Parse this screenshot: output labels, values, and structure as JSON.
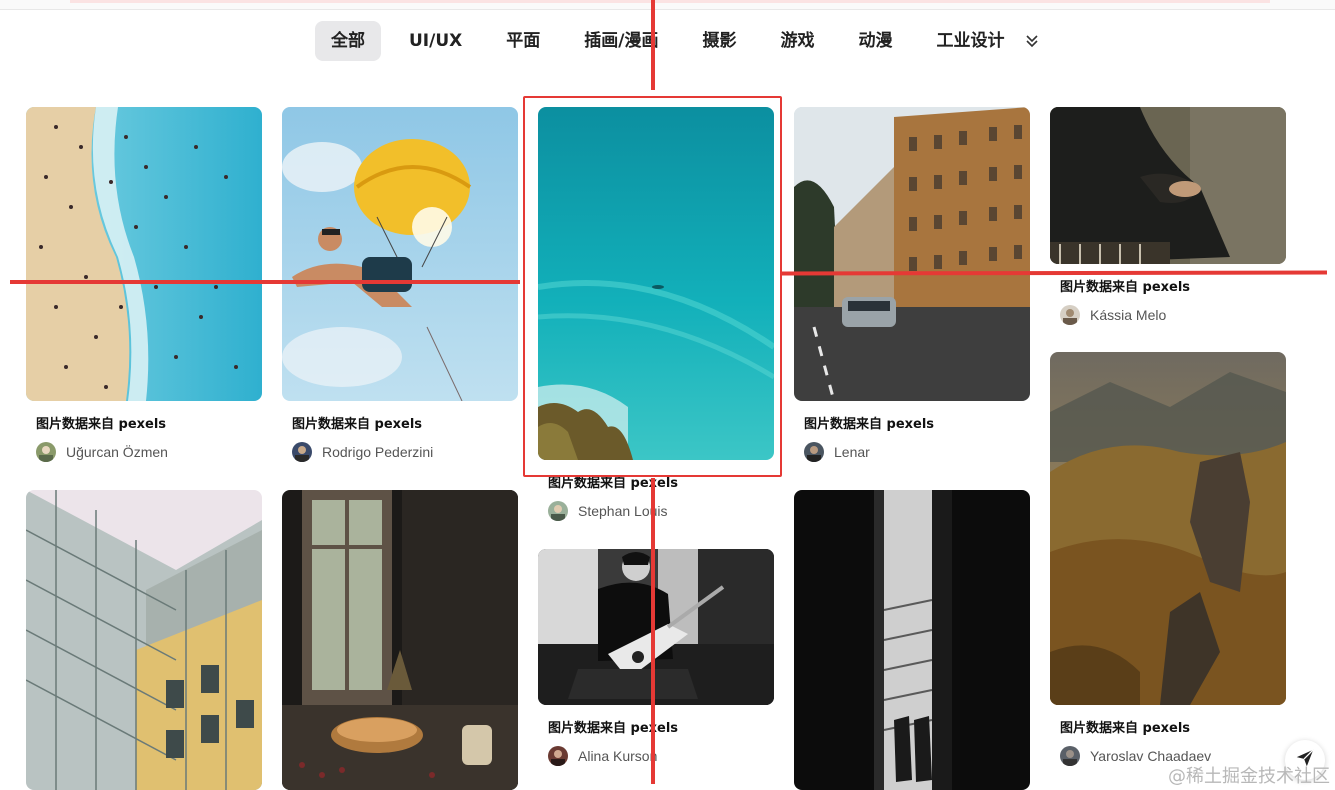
{
  "tabs": [
    {
      "label": "全部",
      "active": true
    },
    {
      "label": "UI/UX"
    },
    {
      "label": "平面"
    },
    {
      "label": "插画/漫画"
    },
    {
      "label": "摄影"
    },
    {
      "label": "游戏"
    },
    {
      "label": "动漫"
    },
    {
      "label": "工业设计"
    }
  ],
  "more_icon": "chevron-double-down-icon",
  "cards": [
    {
      "title": "图片数据来自 pexels",
      "author": "Uğurcan Özmen",
      "scene": "aerial beach with swimmers"
    },
    {
      "title": "图片数据来自 pexels",
      "author": "Rodrigo Pederzini",
      "scene": "man paragliding under yellow parachute"
    },
    {
      "title": "图片数据来自 pexels",
      "author": "Stephan Louis",
      "scene": "turquoise sea waves from cliff"
    },
    {
      "title": "图片数据来自 pexels",
      "author": "Lenar",
      "scene": "city street with old buildings and car"
    },
    {
      "title": "图片数据来自 pexels",
      "author": "Kássia Melo",
      "scene": "seated person in dark dress"
    },
    {
      "title": "图片数据来自 pexels",
      "author": "Alina Kurson",
      "scene": "black and white guitarist on sofa"
    },
    {
      "title": "图片数据来自 pexels",
      "author": "Yaroslav Chaadaev",
      "scene": "mountain landscape with rocks"
    },
    {
      "scene": "glass facade building"
    },
    {
      "scene": "window with pie and candles on table"
    },
    {
      "scene": "dark corridor with light and feet"
    }
  ],
  "watermark": "@稀土掘金技术社区",
  "send_icon": "paper-plane-icon",
  "colors": {
    "annotation_red": "#e53935",
    "active_tab_bg": "#e8e8ea"
  }
}
